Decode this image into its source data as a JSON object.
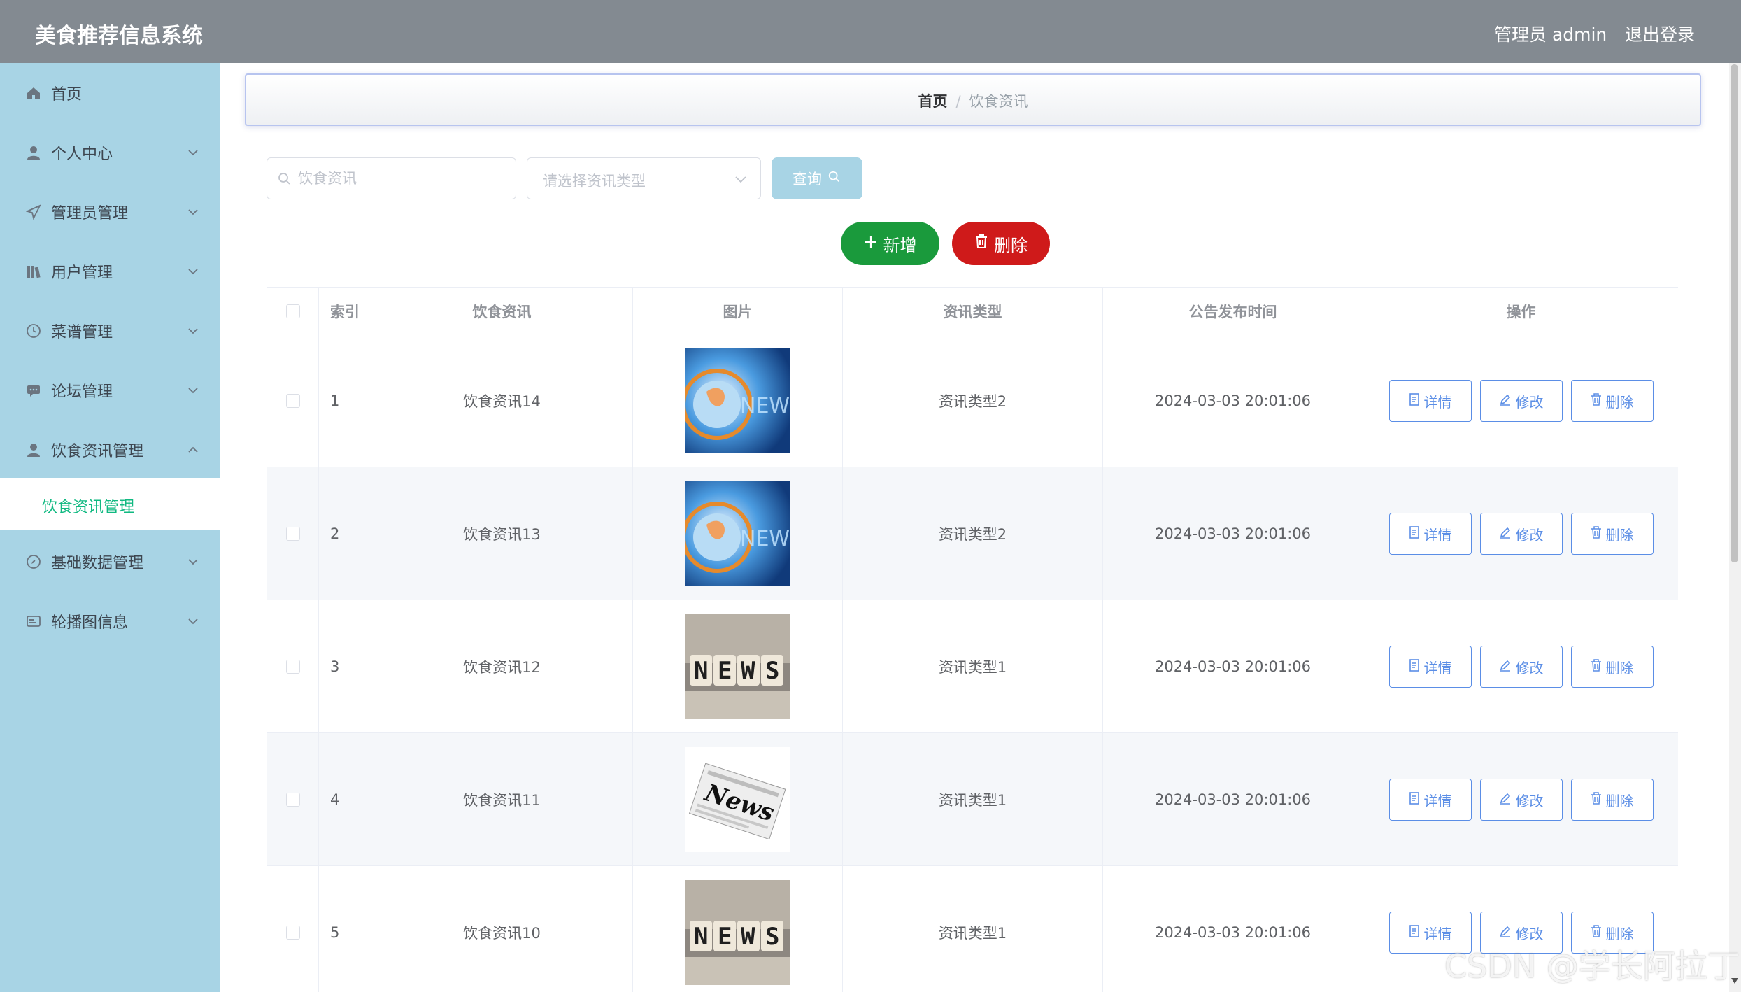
{
  "header": {
    "app_title": "美食推荐信息系统",
    "user_label": "管理员 admin",
    "logout_label": "退出登录",
    "bar_color": "#838a91"
  },
  "sidebar": {
    "bg_color": "#a8d4e5",
    "items": [
      {
        "label": "首页",
        "icon": "home-icon"
      },
      {
        "label": "个人中心",
        "icon": "user-icon"
      },
      {
        "label": "管理员管理",
        "icon": "paper-plane-icon"
      },
      {
        "label": "用户管理",
        "icon": "books-icon"
      },
      {
        "label": "菜谱管理",
        "icon": "clock-icon"
      },
      {
        "label": "论坛管理",
        "icon": "chat-icon"
      },
      {
        "label": "饮食资讯管理",
        "icon": "user-icon"
      },
      {
        "label": "基础数据管理",
        "icon": "compass-icon"
      },
      {
        "label": "轮播图信息",
        "icon": "card-icon"
      }
    ],
    "active_sub_item": "饮食资讯管理",
    "active_color": "#10b981"
  },
  "breadcrumb": {
    "home": "首页",
    "separator": "/",
    "current": "饮食资讯"
  },
  "search": {
    "keyword_placeholder": "饮食资讯",
    "type_placeholder": "请选择资讯类型",
    "query_label": "查询"
  },
  "actions": {
    "add_label": "新增",
    "delete_label": "删除"
  },
  "table": {
    "columns": [
      "索引",
      "饮食资讯",
      "图片",
      "资讯类型",
      "公告发布时间",
      "操作"
    ],
    "rows": [
      {
        "index": "1",
        "title": "饮食资讯14",
        "image": "news-globe",
        "type": "资讯类型2",
        "time": "2024-03-03 20:01:06"
      },
      {
        "index": "2",
        "title": "饮食资讯13",
        "image": "news-globe",
        "type": "资讯类型2",
        "time": "2024-03-03 20:01:06"
      },
      {
        "index": "3",
        "title": "饮食资讯12",
        "image": "news-cubes",
        "type": "资讯类型1",
        "time": "2024-03-03 20:01:06"
      },
      {
        "index": "4",
        "title": "饮食资讯11",
        "image": "news-paper",
        "type": "资讯类型1",
        "time": "2024-03-03 20:01:06"
      },
      {
        "index": "5",
        "title": "饮食资讯10",
        "image": "news-cubes",
        "type": "资讯类型1",
        "time": "2024-03-03 20:01:06"
      }
    ],
    "op_labels": {
      "detail": "详情",
      "edit": "修改",
      "delete": "删除"
    }
  },
  "watermark": "CSDN @学长阿拉丁"
}
